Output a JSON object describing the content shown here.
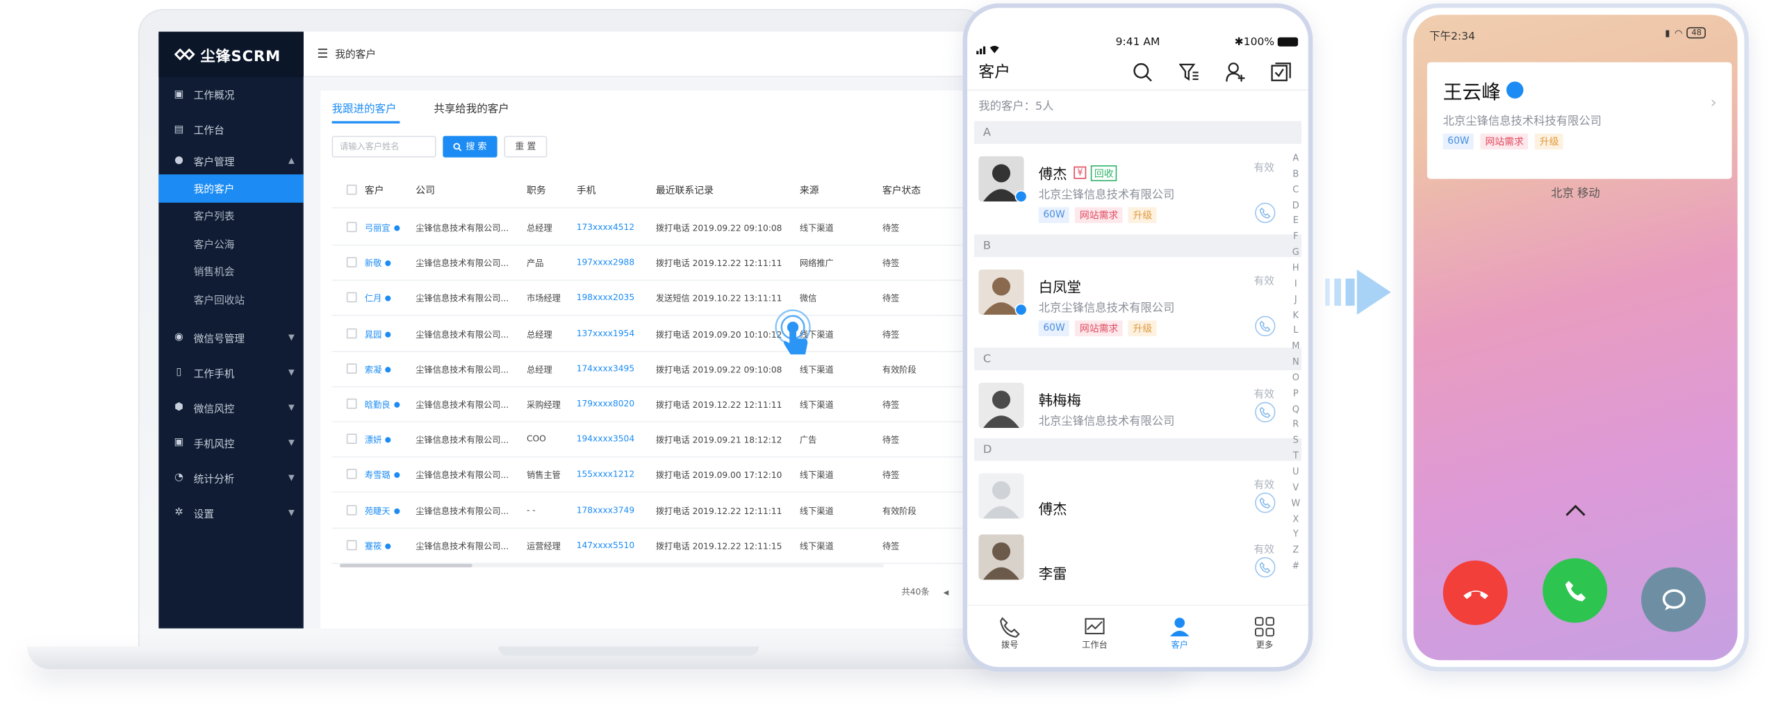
{
  "brand": {
    "logo": "尘锋SCRM"
  },
  "sidebar": {
    "items": [
      {
        "label": "工作概况",
        "icon": "monitor-icon"
      },
      {
        "label": "工作台",
        "icon": "workbench-icon"
      },
      {
        "label": "客户管理",
        "icon": "users-icon",
        "expanded": true,
        "children": [
          "我的客户",
          "客户列表",
          "客户公海",
          "销售机会",
          "客户回收站"
        ],
        "active_child": "我的客户"
      },
      {
        "label": "微信号管理",
        "icon": "wechat-icon"
      },
      {
        "label": "工作手机",
        "icon": "phone-icon"
      },
      {
        "label": "微信风控",
        "icon": "shield-icon"
      },
      {
        "label": "手机风控",
        "icon": "phone-shield-icon"
      },
      {
        "label": "统计分析",
        "icon": "pie-chart-icon"
      },
      {
        "label": "设置",
        "icon": "gear-icon"
      }
    ]
  },
  "topbar": {
    "title": "我的客户"
  },
  "tabs": [
    {
      "label": "我跟进的客户",
      "active": true
    },
    {
      "label": "共享给我的客户",
      "active": false
    }
  ],
  "search": {
    "placeholder": "请输入客户姓名",
    "search_label": "搜 索",
    "reset_label": "重 置"
  },
  "table": {
    "headers": [
      "客户",
      "公司",
      "职务",
      "手机",
      "最近联系记录",
      "来源",
      "客户状态"
    ],
    "rows": [
      {
        "name": "弓丽宜",
        "company": "尘锋信息技术有限公司...",
        "title": "总经理",
        "phone": "173xxxx4512",
        "record": "拨打电话 2019.09.22 09:10:08",
        "source": "线下渠道",
        "status": "待签"
      },
      {
        "name": "新敬",
        "company": "尘锋信息技术有限公司...",
        "title": "产品",
        "phone": "197xxxx2988",
        "record": "拨打电话 2019.12.22 12:11:11",
        "source": "网络推广",
        "status": "待签"
      },
      {
        "name": "仁月",
        "company": "尘锋信息技术有限公司...",
        "title": "市场经理",
        "phone": "198xxxx2035",
        "record": "发送短信 2019.10.22 13:11:11",
        "source": "微信",
        "status": "待签"
      },
      {
        "name": "晁园",
        "company": "尘锋信息技术有限公司...",
        "title": "总经理",
        "phone": "137xxxx1954",
        "record": "拨打电话 2019.09.20 10:10:12",
        "source": "线下渠道",
        "status": "待签"
      },
      {
        "name": "索凝",
        "company": "尘锋信息技术有限公司...",
        "title": "总经理",
        "phone": "174xxxx3495",
        "record": "拨打电话 2019.09.22 09:10:08",
        "source": "线下渠道",
        "status": "有效阶段"
      },
      {
        "name": "晗勤良",
        "company": "尘锋信息技术有限公司...",
        "title": "采购经理",
        "phone": "179xxxx8020",
        "record": "拨打电话 2019.12.22 12:11:11",
        "source": "线下渠道",
        "status": "待签"
      },
      {
        "name": "漂妍",
        "company": "尘锋信息技术有限公司...",
        "title": "COO",
        "phone": "194xxxx3504",
        "record": "拨打电话 2019.09.21 18:12:12",
        "source": "广告",
        "status": "待签"
      },
      {
        "name": "寿雪璐",
        "company": "尘锋信息技术有限公司...",
        "title": "销售主管",
        "phone": "155xxxx1212",
        "record": "拨打电话 2019.09.00 17:12:10",
        "source": "线下渠道",
        "status": "待签"
      },
      {
        "name": "苑睫天",
        "company": "尘锋信息技术有限公司...",
        "title": "- -",
        "phone": "178xxxx3749",
        "record": "拨打电话 2019.12.22 12:11:11",
        "source": "线下渠道",
        "status": "有效阶段"
      },
      {
        "name": "蹇筱",
        "company": "尘锋信息技术有限公司...",
        "title": "运营经理",
        "phone": "147xxxx5510",
        "record": "拨打电话 2019.12.22 12:11:15",
        "source": "线下渠道",
        "status": "待签"
      }
    ],
    "total": "共40条"
  },
  "phone1": {
    "time": "9:41 AM",
    "battery": "100%",
    "title": "客户",
    "count": "我的客户：5人",
    "sections": [
      {
        "letter": "A",
        "contacts": [
          {
            "name": "傅杰",
            "company": "北京尘锋信息技术有限公司",
            "badges": [
              "¥",
              "回收"
            ],
            "tags": [
              "60W",
              "网站需求",
              "升级"
            ],
            "status": "有效",
            "wechat": true
          }
        ]
      },
      {
        "letter": "B",
        "contacts": [
          {
            "name": "白凤堂",
            "company": "北京尘锋信息技术有限公司",
            "tags": [
              "60W",
              "网站需求",
              "升级"
            ],
            "status": "有效",
            "wechat": true
          }
        ]
      },
      {
        "letter": "C",
        "contacts": [
          {
            "name": "韩梅梅",
            "company": "北京尘锋信息技术有限公司",
            "status": "有效"
          }
        ]
      },
      {
        "letter": "D",
        "contacts": [
          {
            "name": "傅杰",
            "status": "有效"
          },
          {
            "name": "李雷",
            "status": "有效"
          }
        ]
      }
    ],
    "alphabet": [
      "A",
      "B",
      "C",
      "D",
      "E",
      "F",
      "G",
      "H",
      "I",
      "J",
      "K",
      "L",
      "M",
      "N",
      "O",
      "P",
      "Q",
      "R",
      "S",
      "T",
      "U",
      "V",
      "W",
      "X",
      "Y",
      "Z",
      "#"
    ],
    "bottom_tabs": [
      {
        "label": "拨号",
        "icon": "dial-icon"
      },
      {
        "label": "工作台",
        "icon": "workbench-icon"
      },
      {
        "label": "客户",
        "icon": "user-icon",
        "active": true
      },
      {
        "label": "更多",
        "icon": "grid-icon"
      }
    ]
  },
  "phone2": {
    "time": "下午2:34",
    "battery": "48",
    "caller": "王云峰",
    "company": "北京尘锋信息技术科技有限公司",
    "tags": [
      "60W",
      "网站需求",
      "升级"
    ],
    "carrier": "北京 移动"
  },
  "colors": {
    "primary": "#1c8cf4",
    "sidebar": "#0f1c33",
    "decline": "#f23f3a",
    "accept": "#2ec450",
    "message": "#6e8fa3"
  }
}
